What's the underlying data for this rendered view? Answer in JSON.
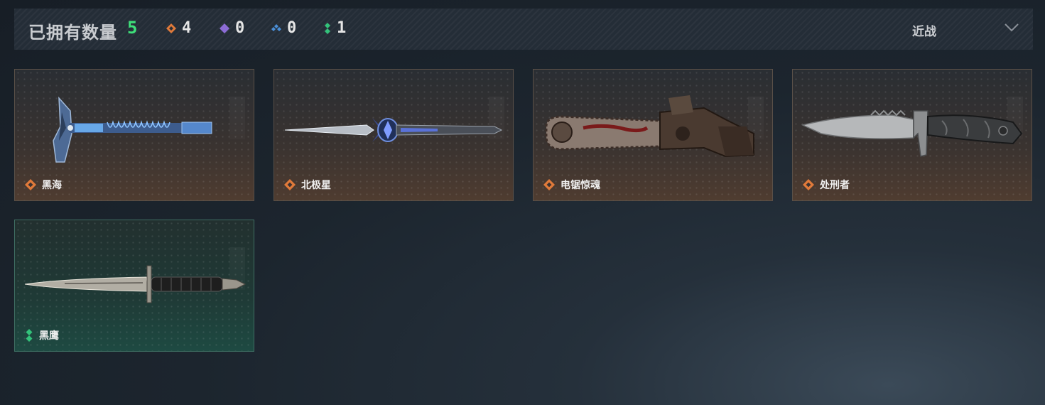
{
  "header": {
    "title": "已拥有数量",
    "total": "5",
    "rarities": [
      {
        "name": "orange-diamond-icon",
        "color": "#e07a3a",
        "count": "4"
      },
      {
        "name": "purple-diamond-icon",
        "color": "#8c6cd6",
        "count": "0"
      },
      {
        "name": "blue-diamond-icon",
        "color": "#4a8fd8",
        "count": "0"
      },
      {
        "name": "green-diamond-icon",
        "color": "#33c27a",
        "count": "1"
      }
    ],
    "filter_label": "近战"
  },
  "items": [
    {
      "name": "黑海",
      "rarity": "orange"
    },
    {
      "name": "北极星",
      "rarity": "orange"
    },
    {
      "name": "电锯惊魂",
      "rarity": "orange"
    },
    {
      "name": "处刑者",
      "rarity": "orange"
    },
    {
      "name": "黑鹰",
      "rarity": "green"
    }
  ]
}
